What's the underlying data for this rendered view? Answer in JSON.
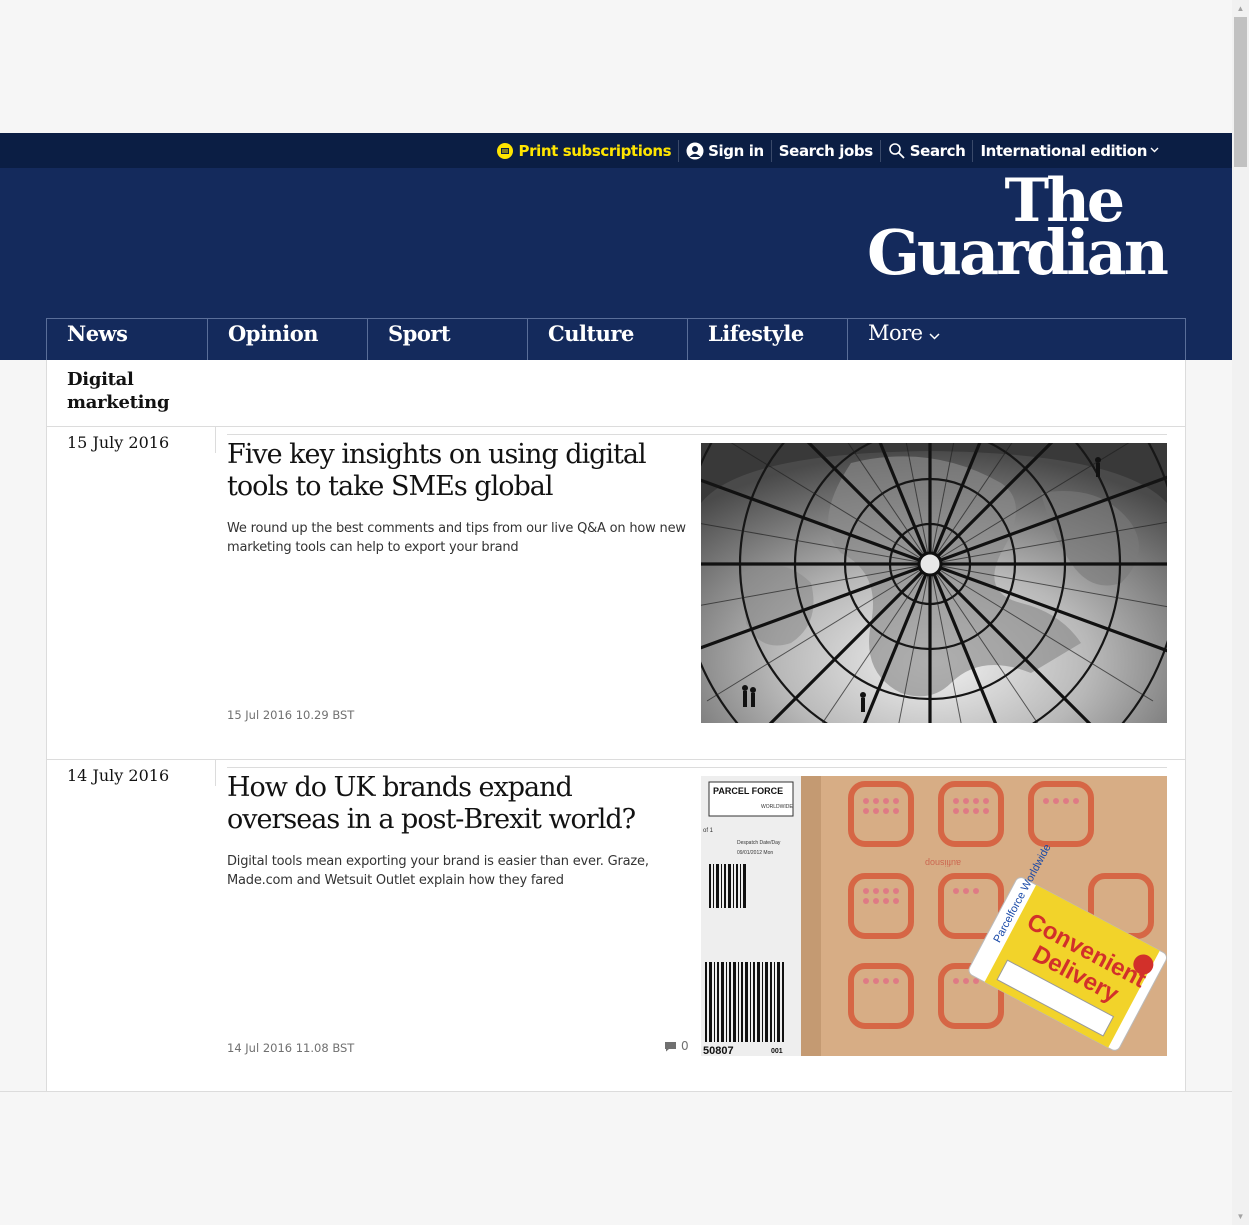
{
  "topbar": {
    "print_subscriptions": "Print subscriptions",
    "sign_in": "Sign in",
    "search_jobs": "Search jobs",
    "search": "Search",
    "edition": "International edition"
  },
  "logo": {
    "line1": "The",
    "line2": "Guardian"
  },
  "nav": {
    "items": [
      {
        "label": "News"
      },
      {
        "label": "Opinion"
      },
      {
        "label": "Sport"
      },
      {
        "label": "Culture"
      },
      {
        "label": "Lifestyle"
      }
    ],
    "more": "More"
  },
  "section": {
    "title": "Digital marketing"
  },
  "days": [
    {
      "date": "15 July 2016",
      "headline": "Five key insights on using digital tools to take SMEs global",
      "trail": "We round up the best comments and tips from our live Q&A on how new marketing tools can help to export your brand",
      "timestamp": "15 Jul 2016 10.29 BST",
      "image": "globe-dome-photo"
    },
    {
      "date": "14 July 2016",
      "headline": "How do UK brands expand overseas in a post-Brexit world?",
      "trail": "Digital tools mean exporting your brand is easier than ever. Graze, Made.com and Wetsuit Outlet explain how they fared",
      "timestamp": "14 Jul 2016 11.08 BST",
      "comments": "0",
      "image": "parcel-label-photo",
      "image_text": {
        "brand": "PARCEL FORCE",
        "brand_sub": "WORLDWIDE",
        "despatch": "Despatch Date/Day",
        "despatch_date": "09/01/2012 Mon",
        "label_left": "of 1",
        "barcode_num": "50807",
        "barcode_num2": "001",
        "sticker_top": "Parcelforce Worldwide",
        "sticker_main1": "Convenient",
        "sticker_main2": "Delivery",
        "tape_text": "aufiisnop"
      }
    }
  ],
  "colors": {
    "topbar_bg": "#0b1e44",
    "masthead_bg": "#142a5c",
    "print_accent": "#ffe500"
  }
}
